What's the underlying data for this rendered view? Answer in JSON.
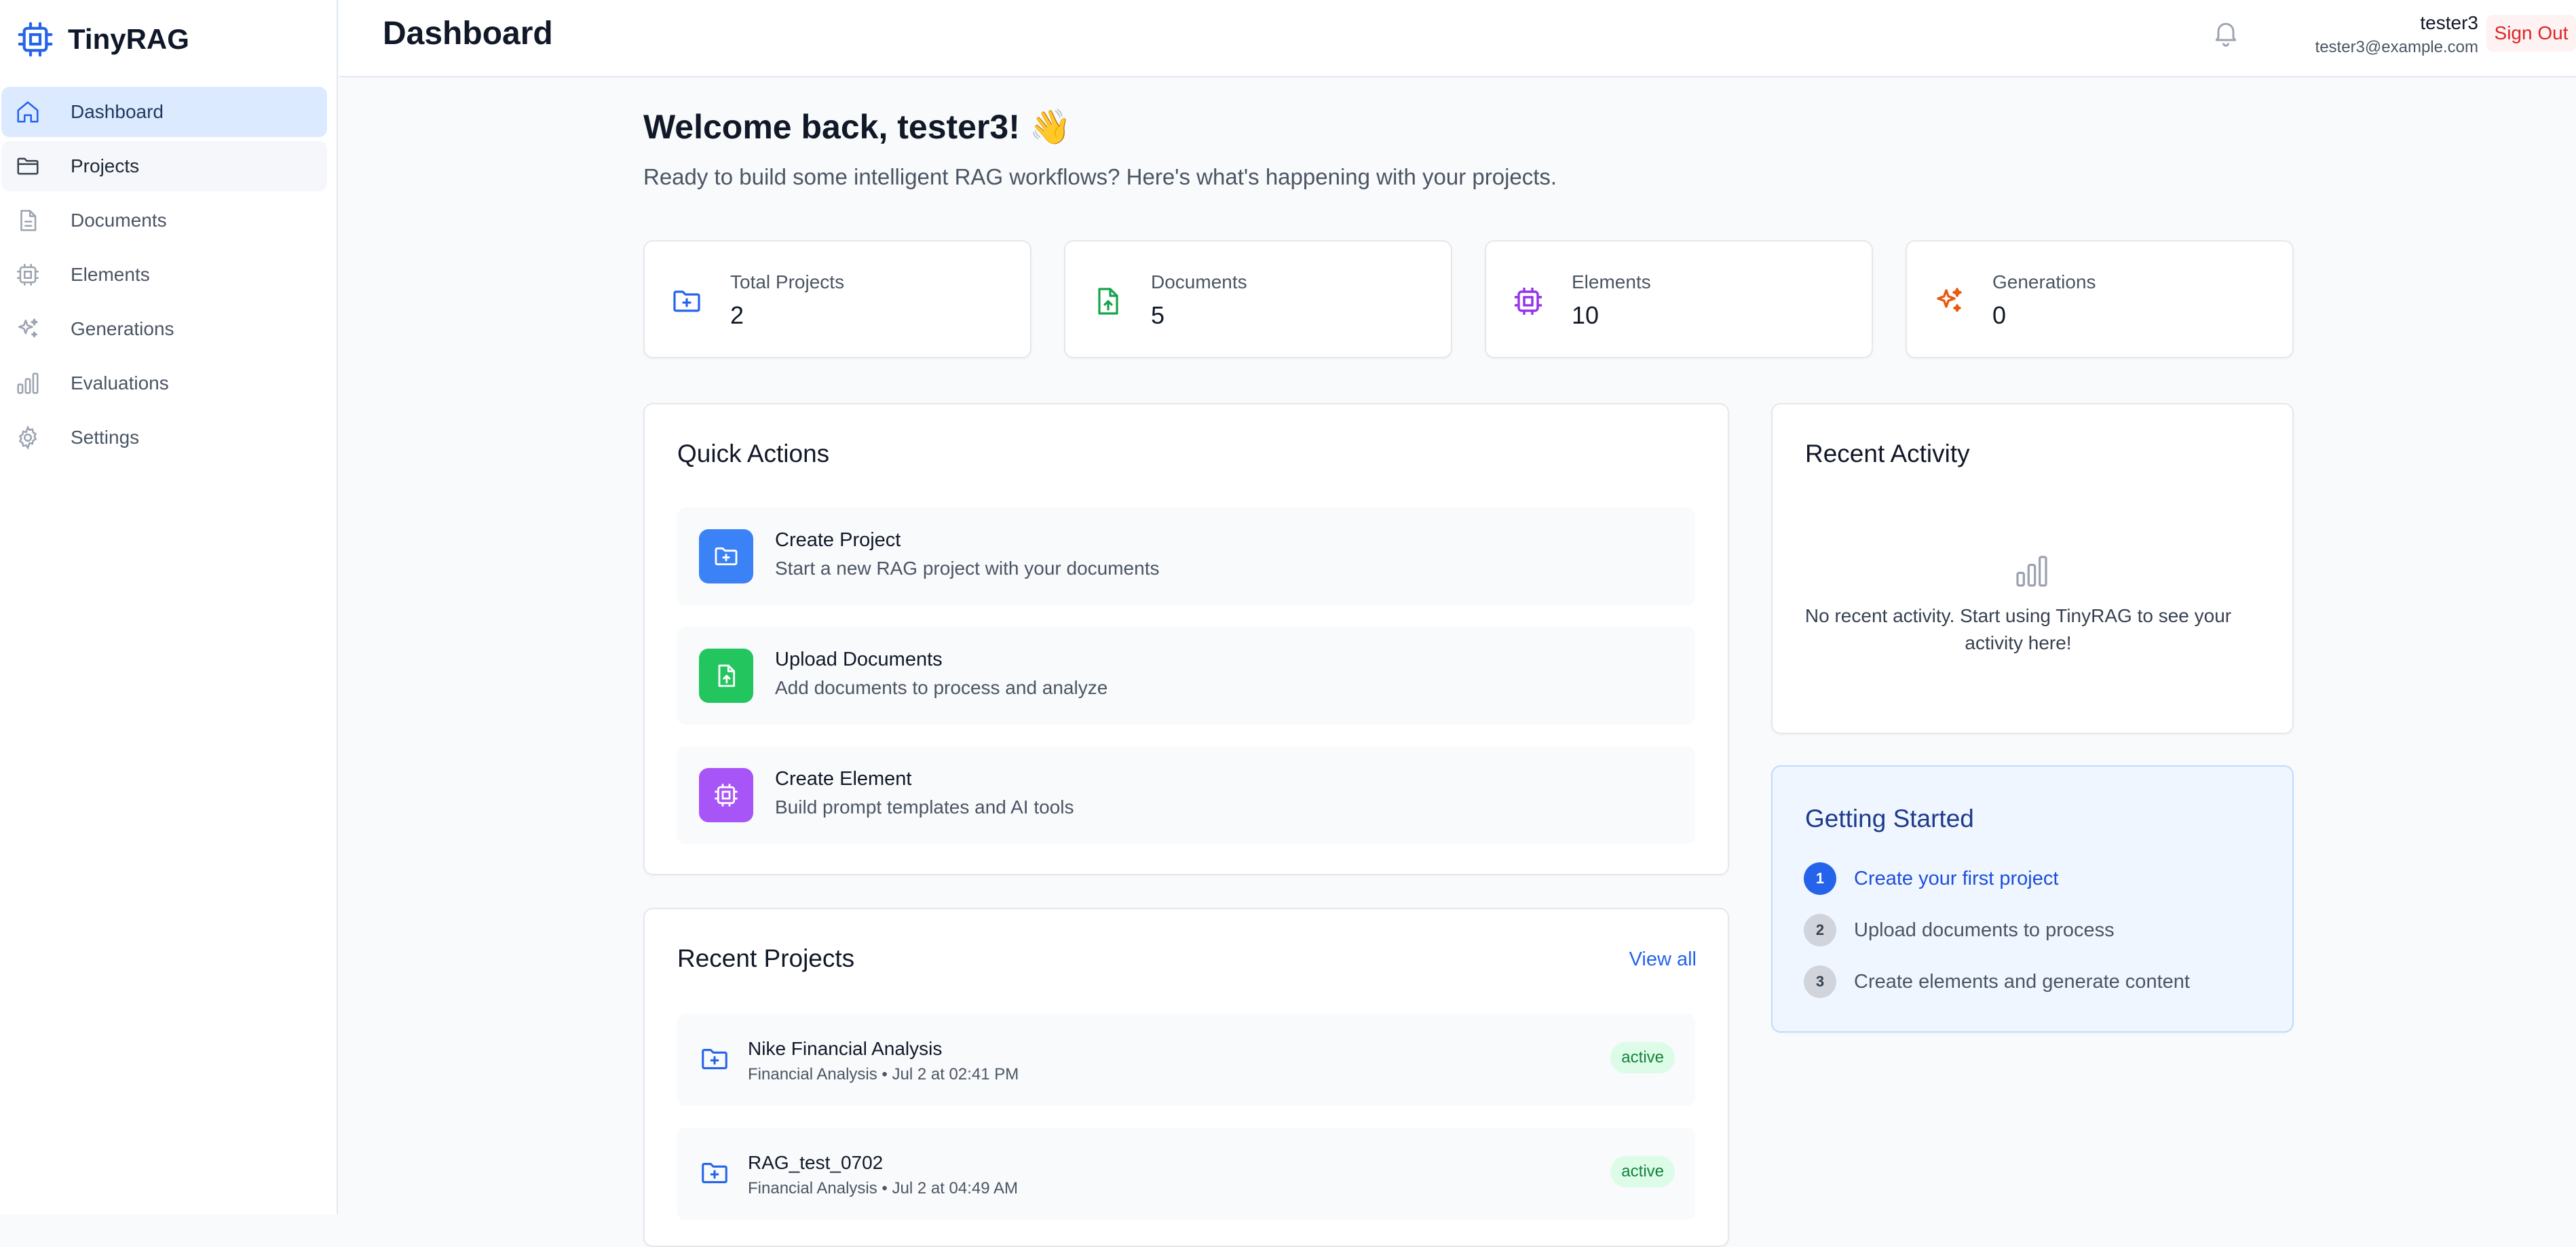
{
  "app": {
    "name": "TinyRAG"
  },
  "sidebar": {
    "items": [
      {
        "label": "Dashboard",
        "icon": "home-icon",
        "active": true
      },
      {
        "label": "Projects",
        "icon": "folder-icon"
      },
      {
        "label": "Documents",
        "icon": "document-icon"
      },
      {
        "label": "Elements",
        "icon": "chip-icon"
      },
      {
        "label": "Generations",
        "icon": "sparkles-icon"
      },
      {
        "label": "Evaluations",
        "icon": "bar-chart-icon"
      },
      {
        "label": "Settings",
        "icon": "gear-icon"
      }
    ]
  },
  "header": {
    "title": "Dashboard",
    "user_name": "tester3",
    "user_email": "tester3@example.com",
    "sign_out": "Sign Out"
  },
  "welcome": {
    "title": "Welcome back, tester3! 👋",
    "subtitle": "Ready to build some intelligent RAG workflows? Here's what's happening with your projects."
  },
  "stats": [
    {
      "label": "Total Projects",
      "value": "2",
      "icon": "folder-plus-icon",
      "color": "#2563eb"
    },
    {
      "label": "Documents",
      "value": "5",
      "icon": "file-upload-icon",
      "color": "#16a34a"
    },
    {
      "label": "Elements",
      "value": "10",
      "icon": "chip-icon",
      "color": "#9333ea"
    },
    {
      "label": "Generations",
      "value": "0",
      "icon": "sparkles-icon",
      "color": "#ea580c"
    }
  ],
  "quick_actions": {
    "title": "Quick Actions",
    "items": [
      {
        "title": "Create Project",
        "desc": "Start a new RAG project with your documents",
        "color": "#3b82f6",
        "icon": "folder-plus-icon"
      },
      {
        "title": "Upload Documents",
        "desc": "Add documents to process and analyze",
        "color": "#22c55e",
        "icon": "file-upload-icon"
      },
      {
        "title": "Create Element",
        "desc": "Build prompt templates and AI tools",
        "color": "#a855f7",
        "icon": "chip-icon"
      }
    ]
  },
  "recent_projects": {
    "title": "Recent Projects",
    "view_all": "View all",
    "items": [
      {
        "name": "Nike Financial Analysis",
        "meta": "Financial Analysis • Jul 2 at 02:41 PM",
        "status": "active"
      },
      {
        "name": "RAG_test_0702",
        "meta": "Financial Analysis • Jul 2 at 04:49 AM",
        "status": "active"
      }
    ]
  },
  "recent_activity": {
    "title": "Recent Activity",
    "empty": "No recent activity. Start using TinyRAG to see your activity here!"
  },
  "getting_started": {
    "title": "Getting Started",
    "steps": [
      {
        "num": "1",
        "label": "Create your first project",
        "current": true
      },
      {
        "num": "2",
        "label": "Upload documents to process"
      },
      {
        "num": "3",
        "label": "Create elements and generate content"
      }
    ]
  }
}
